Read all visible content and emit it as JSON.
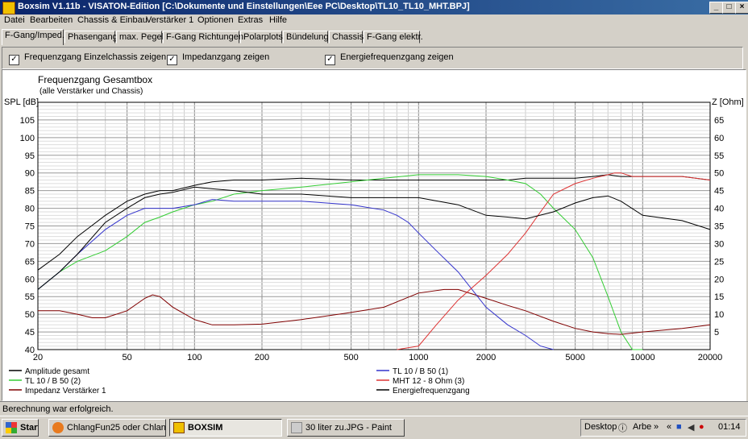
{
  "window": {
    "title": "Boxsim V1.11b - VISATON-Edition [C:\\Dokumente und Einstellungen\\Eee PC\\Desktop\\TL10_TL10_MHT.BPJ]",
    "min": "_",
    "max": "□",
    "close": "×"
  },
  "menu": [
    "Datei",
    "Bearbeiten",
    "Chassis & Einbau",
    "Verstärker 1",
    "Optionen",
    "Extras",
    "Hilfe"
  ],
  "tabs": [
    "F-Gang/Imped.",
    "Phasengang",
    "max. Pegel",
    "F-Gang Richtungen",
    "Polarplots",
    "Bündelung",
    "Chassis",
    "F-Gang elektr."
  ],
  "checks": [
    {
      "label": "Frequenzgang Einzelchassis zeigen",
      "checked": true
    },
    {
      "label": "Impedanzgang zeigen",
      "checked": true
    },
    {
      "label": "Energiefrequenzgang zeigen",
      "checked": true
    }
  ],
  "status": "Berechnung war erfolgreich.",
  "taskbar": {
    "start": "Start",
    "items": [
      "ChlangFun25 oder Chlan...",
      "BOXSIM",
      "30 liter zu.JPG - Paint"
    ],
    "desktop": "Desktop",
    "arbe": "Arbe",
    "clock": "01:14"
  },
  "chart_data": {
    "type": "line",
    "title": "Frequenzgang Gesamtbox",
    "subtitle": "(alle Verstärker und Chassis)",
    "ylabel_left": "SPL [dB]",
    "ylabel_right": "Z [Ohm]",
    "x_scale": "log",
    "xlim": [
      20,
      20000
    ],
    "ylim_left": [
      40,
      110
    ],
    "ylim_right": [
      0,
      70
    ],
    "x_ticks": [
      20,
      50,
      100,
      200,
      500,
      1000,
      2000,
      5000,
      10000,
      20000
    ],
    "y_ticks_left": [
      40,
      45,
      50,
      55,
      60,
      65,
      70,
      75,
      80,
      85,
      90,
      95,
      100,
      105
    ],
    "y_ticks_right": [
      5,
      10,
      15,
      20,
      25,
      30,
      35,
      40,
      45,
      50,
      55,
      60,
      65
    ],
    "grid": true,
    "series": [
      {
        "name": "Amplitude gesamt",
        "color": "#000000",
        "axis": "left",
        "x": [
          20,
          25,
          30,
          40,
          50,
          60,
          70,
          80,
          100,
          120,
          150,
          200,
          300,
          500,
          700,
          1000,
          1500,
          2000,
          2500,
          3000,
          3500,
          4000,
          5000,
          6000,
          7000,
          8000,
          10000,
          15000,
          20000
        ],
        "y": [
          62.5,
          67,
          72,
          78,
          82,
          84,
          85,
          85,
          86.5,
          87.5,
          88,
          88,
          88.5,
          88,
          88,
          88,
          88,
          88,
          88,
          88.5,
          88.5,
          88.5,
          88.5,
          89,
          89.5,
          89,
          89,
          89,
          88
        ]
      },
      {
        "name": "TL 10 / B 50 (2)",
        "color": "#33cc33",
        "axis": "left",
        "x": [
          20,
          25,
          30,
          40,
          50,
          60,
          70,
          80,
          100,
          120,
          150,
          200,
          300,
          500,
          700,
          1000,
          1500,
          2000,
          2500,
          3000,
          3500,
          4000,
          5000,
          6000,
          7000,
          8000,
          9000,
          10000
        ],
        "y": [
          57,
          62,
          65,
          68,
          72,
          76,
          77.5,
          79,
          81,
          82,
          84,
          85,
          86,
          87.5,
          88.5,
          89.5,
          89.5,
          89,
          88,
          87,
          84,
          80,
          74,
          66,
          55,
          45,
          40,
          38
        ]
      },
      {
        "name": "Impedanz Verstärker 1",
        "color": "#800000",
        "axis": "right",
        "x": [
          20,
          25,
          30,
          35,
          40,
          50,
          60,
          65,
          70,
          80,
          100,
          120,
          150,
          200,
          300,
          500,
          700,
          1000,
          1300,
          1500,
          2000,
          2500,
          3000,
          4000,
          5000,
          6000,
          7000,
          8000,
          10000,
          15000,
          20000
        ],
        "y": [
          11,
          11,
          10,
          9,
          9,
          11,
          14.5,
          15.5,
          15,
          12,
          8.5,
          7,
          7,
          7.2,
          8.5,
          10.5,
          12,
          16,
          17,
          17,
          14.5,
          12.5,
          11,
          8,
          6,
          5,
          4.5,
          4.3,
          5,
          6,
          7
        ]
      },
      {
        "name": "TL 10 / B 50 (1)",
        "color": "#3333cc",
        "axis": "left",
        "x": [
          20,
          25,
          30,
          40,
          50,
          60,
          70,
          80,
          100,
          120,
          150,
          200,
          300,
          500,
          700,
          800,
          900,
          1000,
          1200,
          1500,
          2000,
          2500,
          3000,
          3500,
          4000
        ],
        "y": [
          57,
          62,
          67,
          74,
          78,
          80,
          80,
          80,
          81,
          82.5,
          82,
          82,
          82,
          81,
          79.5,
          78,
          76,
          73,
          68,
          62,
          52,
          47,
          44,
          41,
          38
        ]
      },
      {
        "name": "MHT 12 - 8 Ohm (3)",
        "color": "#dd3333",
        "axis": "left",
        "x": [
          800,
          1000,
          1200,
          1500,
          2000,
          2500,
          3000,
          3500,
          4000,
          5000,
          6000,
          7000,
          7500,
          8000,
          9000,
          10000,
          15000,
          20000
        ],
        "y": [
          38,
          41,
          47,
          54,
          61,
          67,
          73,
          79,
          84,
          87,
          88.5,
          89.5,
          90,
          90,
          89,
          89,
          89,
          88
        ]
      },
      {
        "name": "Energiefrequenzgang",
        "color": "#000000",
        "axis": "left",
        "x": [
          20,
          25,
          30,
          40,
          50,
          60,
          70,
          80,
          100,
          120,
          150,
          200,
          300,
          500,
          700,
          1000,
          1500,
          2000,
          2500,
          3000,
          4000,
          5000,
          6000,
          7000,
          8000,
          10000,
          15000,
          20000
        ],
        "y": [
          57,
          62,
          67,
          76,
          80,
          83,
          84,
          84.5,
          86,
          85.5,
          85,
          84,
          84,
          83,
          83,
          83,
          81,
          78,
          77.5,
          77,
          79,
          81.5,
          83,
          83.5,
          82,
          78,
          76.5,
          74
        ]
      }
    ]
  }
}
